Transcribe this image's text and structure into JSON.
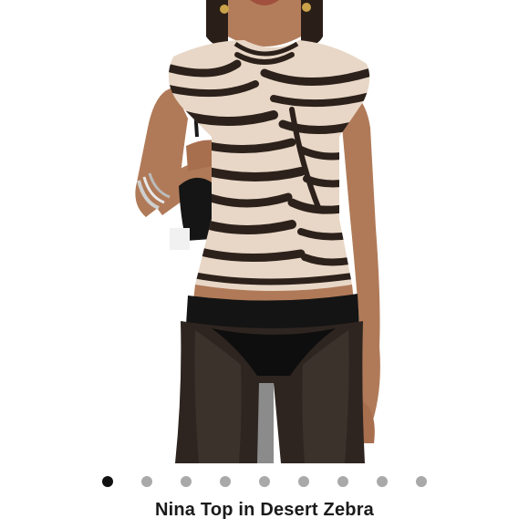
{
  "product": {
    "title": "Nina Top in Desert Zebra"
  },
  "carousel": {
    "total_images": 9,
    "active_index": 0,
    "active_color": "#111111",
    "inactive_color": "#a9a9a9"
  },
  "image": {
    "subject": "product-model-photo"
  }
}
